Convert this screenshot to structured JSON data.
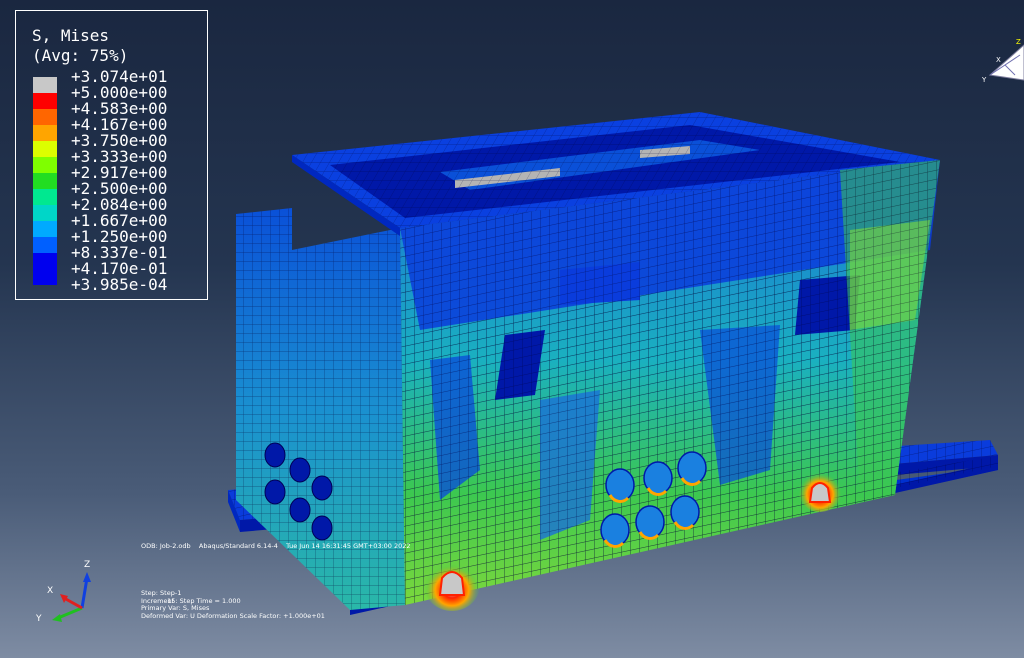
{
  "legend": {
    "title": "S, Mises",
    "subtitle": "(Avg: 75%)",
    "levels": [
      {
        "label": "+3.074e+01",
        "color": "#c8c8c8"
      },
      {
        "label": "+5.000e+00",
        "color": "#c8c8c8"
      },
      {
        "label": "+4.583e+00",
        "color": "#ff0000"
      },
      {
        "label": "+4.167e+00",
        "color": "#ff6600"
      },
      {
        "label": "+3.750e+00",
        "color": "#ffa500"
      },
      {
        "label": "+3.333e+00",
        "color": "#dcff00"
      },
      {
        "label": "+2.917e+00",
        "color": "#7fff00"
      },
      {
        "label": "+2.500e+00",
        "color": "#22dd22"
      },
      {
        "label": "+2.084e+00",
        "color": "#00e890"
      },
      {
        "label": "+1.667e+00",
        "color": "#00d6c8"
      },
      {
        "label": "+1.250e+00",
        "color": "#00aaff"
      },
      {
        "label": "+8.337e-01",
        "color": "#0060ff"
      },
      {
        "label": "+4.170e-01",
        "color": "#0000ee"
      },
      {
        "label": "+3.985e-04",
        "color": "#0000ee"
      }
    ]
  },
  "odb_line": {
    "file": "ODB: Job-2.odb",
    "version": "Abaqus/Standard 6.14-4",
    "timestamp": "Tue Jun 14 16:31:45 GMT+03:00 2022"
  },
  "step_info": {
    "step": "Step: Step-1",
    "increment_label": "Increment",
    "increment": "15: Step Time =    1.000",
    "primary_var": "Primary Var: S, Mises",
    "deformed_var": "Deformed Var: U   Deformation Scale Factor: +1.000e+01"
  },
  "triad_axes": {
    "x": "X",
    "y": "Y",
    "z": "Z"
  },
  "view_cube_axes": {
    "x": "X",
    "y": "Y",
    "z": "Z"
  },
  "colors": {
    "mesh_blue": "#0a3cdc",
    "mesh_dark": "#0018a8",
    "mesh_cyan": "#1ab4c8",
    "mesh_green": "#3cc850",
    "mesh_yellow": "#b4dc28",
    "hotspot_red": "#ff2000"
  }
}
